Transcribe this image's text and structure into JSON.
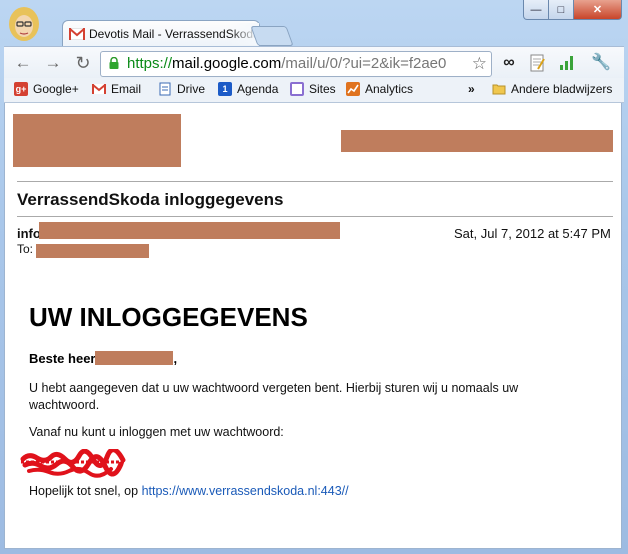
{
  "browser": {
    "tab_title": "Devotis Mail - VerrassendSkoda",
    "url_scheme": "https://",
    "url_host": "mail.google.com",
    "url_path": "/mail/u/0/?ui=2&ik=f2ae0",
    "window_controls": {
      "minimize": "—",
      "maximize": "□",
      "close": "✕"
    }
  },
  "bookmarks": [
    {
      "label": "Google+",
      "icon": "google-plus-icon",
      "color": "#d44132"
    },
    {
      "label": "Email",
      "icon": "gmail-icon",
      "color": "#d44132"
    },
    {
      "label": "Drive",
      "icon": "drive-icon",
      "color": "#3b6bb5"
    },
    {
      "label": "Agenda",
      "icon": "calendar-icon",
      "color": "#1c5bc7"
    },
    {
      "label": "Sites",
      "icon": "sites-icon",
      "color": "#8a6fd1"
    },
    {
      "label": "Analytics",
      "icon": "analytics-icon",
      "color": "#e0731f"
    }
  ],
  "bookmarks_overflow": "»",
  "other_bookmarks": "Andere bladwijzers",
  "email": {
    "subject": "VerrassendSkoda inloggegevens",
    "from_prefix": "info",
    "date": "Sat, Jul 7, 2012 at 5:47 PM",
    "to_label": "To:",
    "heading": "UW INLOGGEGEVENS",
    "greeting_prefix": "Beste heer",
    "greeting_suffix": ",",
    "paragraph1": "U hebt aangegeven dat u uw wachtwoord vergeten bent. Hierbij sturen wij u nomaals uw wachtwoord.",
    "paragraph2": "Vanaf nu kunt u inloggen met uw wachtwoord:",
    "closing_text": "Hopelijk tot snel, op ",
    "closing_link": "https://www.verrassendskoda.nl:443//"
  },
  "colors": {
    "redaction": "#bf7d5d",
    "link": "#1a5ab8",
    "scribble": "#e0121b"
  }
}
